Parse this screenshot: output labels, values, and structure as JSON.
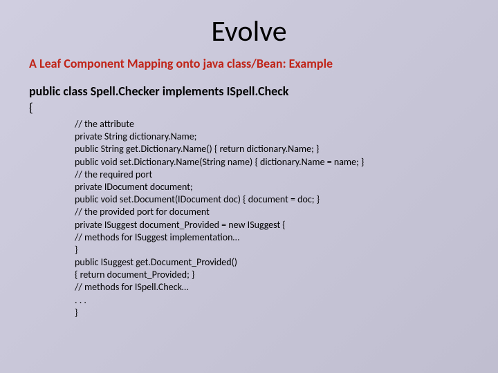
{
  "title": "Evolve",
  "subtitle": "A Leaf Component Mapping onto java class/Bean: Example",
  "class_decl": "public class Spell.Checker implements ISpell.Check",
  "open_brace": "{",
  "code": {
    "l1": "// the attribute",
    "l2": "private String dictionary.Name;",
    "l3": "public String get.Dictionary.Name() { return dictionary.Name; }",
    "l4": "public void set.Dictionary.Name(String name) { dictionary.Name = name; }",
    "l5": "// the required port",
    "l6": "private IDocument document;",
    "l7": "public void set.Document(IDocument doc) { document = doc; }",
    "l8": "// the provided port for document",
    "l9": "private ISuggest document_Provided = new ISuggest {",
    "l10": "// methods for ISuggest implementation…",
    "l11": "}",
    "l12": "public ISuggest get.Document_Provided()",
    "l13": "{ return document_Provided; }",
    "l14": "// methods for ISpell.Check…",
    "l15": ". . .",
    "l16": "}"
  }
}
